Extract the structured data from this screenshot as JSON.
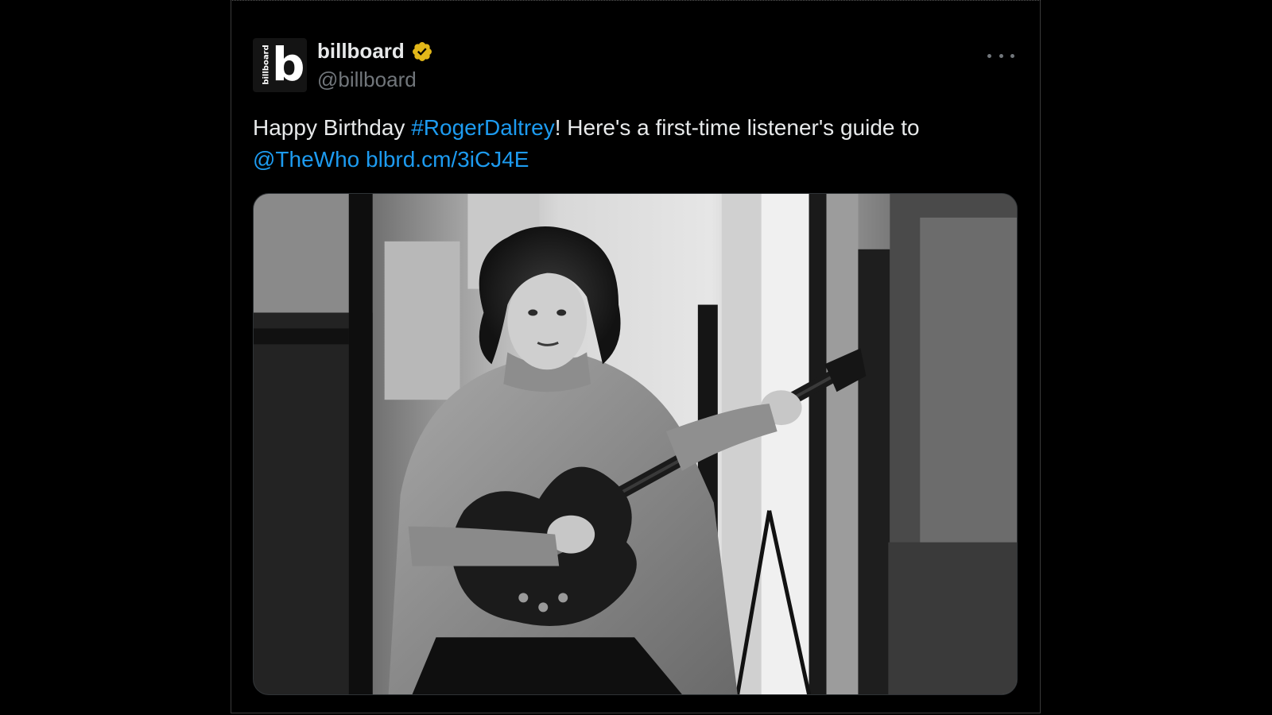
{
  "tweet": {
    "author": {
      "display_name": "billboard",
      "handle": "@billboard",
      "avatar_letter": "b",
      "avatar_wordmark": "billboard",
      "verified_icon": "verified-badge-icon",
      "verified_color": "#e2b719"
    },
    "more_icon": "more-options-icon",
    "text": {
      "part1": "Happy Birthday ",
      "hashtag": "#RogerDaltrey",
      "part2": "! Here's a first-time listener's guide to",
      "mention": "@TheWho",
      "space": " ",
      "url": "blbrd.cm/3iCJ4E"
    },
    "media": {
      "type": "photo",
      "icon": "photo-icon"
    }
  },
  "colors": {
    "background": "#000000",
    "text": "#e7e9ea",
    "secondary": "#71767b",
    "link": "#1d9bf0"
  }
}
